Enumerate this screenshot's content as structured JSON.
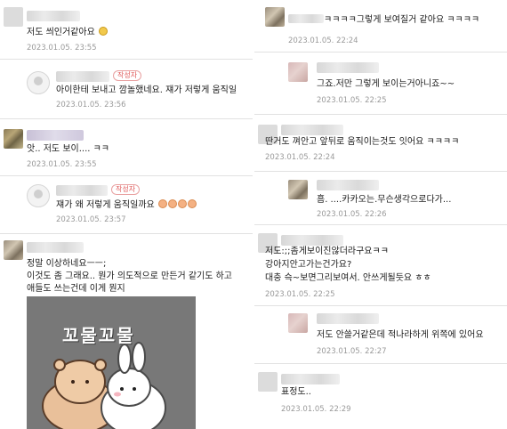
{
  "left": {
    "comments": [
      {
        "text": "저도 씌인거같아요",
        "date": "2023.01.05. 23:55"
      },
      {
        "badge": "작성자",
        "text": "아이한테 보내고 깜놀했네요. 쟤가 저렇게 움직일",
        "date": "2023.01.05. 23:56"
      },
      {
        "text": "앗.. 저도 보이.... ㅋㅋ",
        "date": "2023.01.05. 23:55"
      },
      {
        "badge": "작성자",
        "text": "쟤가 왜 저렇게 움직일까요",
        "date": "2023.01.05. 23:57"
      },
      {
        "text_lines": [
          "정말 이상하네요ㅡㅡ;",
          "이것도 좀 그래요.. 뭔가 의도적으로 만든거 같기도 하고",
          "애들도 쓰는건데 이게 뭔지"
        ]
      }
    ],
    "sticker": {
      "caption": "꼬물꼬물"
    }
  },
  "right": {
    "comments": [
      {
        "text": "ㅋㅋㅋㅋ그렇게 보여질거 같아요 ㅋㅋㅋㅋ",
        "date": "2023.01.05. 22:24"
      },
      {
        "text": "그죠.저만 그렇게 보이는거아니죠~~",
        "date": "2023.01.05. 22:25"
      },
      {
        "text": "딴거도 껴안고 앞뒤로 움직이는것도 잇어요 ㅋㅋㅋㅋ",
        "date": "2023.01.05. 22:24"
      },
      {
        "text": "흠. ....카카오는.무슨생각으로다가...",
        "date": "2023.01.05. 22:26"
      },
      {
        "text_lines": [
          "저도:;;좀게보이진않더라구요ㅋㅋ",
          "강아지안고가는건가요?",
          "대충 슥~보면그리보여서. 안쓰게될듯요 ㅎㅎ"
        ],
        "date": "2023.01.05. 22:25"
      },
      {
        "text": "저도 안쓸거같은데 적나라하게 위쪽에 있어요",
        "date": "2023.01.05. 22:27"
      },
      {
        "text": "표정도..",
        "date": "2023.01.05. 22:29"
      }
    ]
  }
}
